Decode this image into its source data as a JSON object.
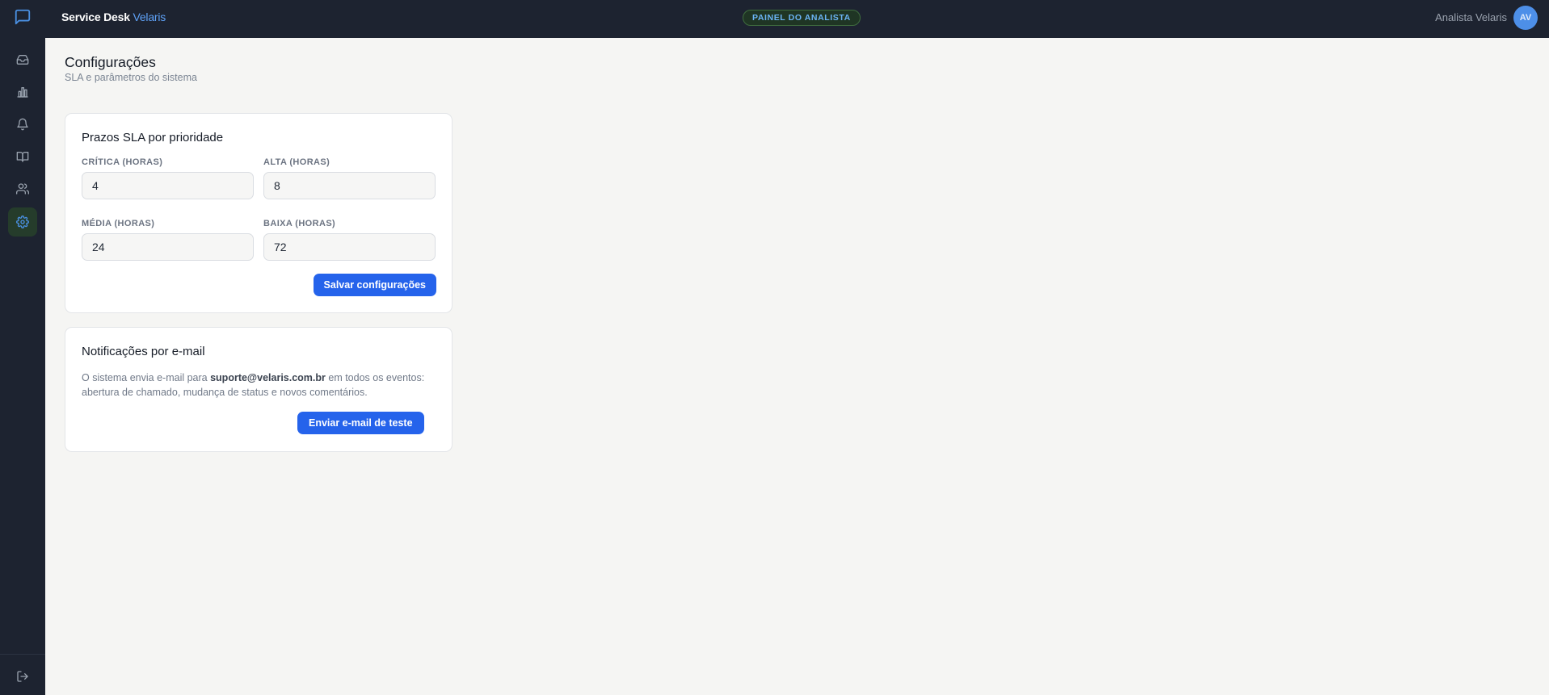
{
  "header": {
    "brand_primary": "Service Desk",
    "brand_accent": "Velaris",
    "badge": "PAINEL DO ANALISTA",
    "user_name": "Analista Velaris",
    "avatar_initials": "AV"
  },
  "sidebar": {
    "items": [
      {
        "icon": "inbox-icon",
        "active": false
      },
      {
        "icon": "bar-chart-icon",
        "active": false
      },
      {
        "icon": "bell-icon",
        "active": false
      },
      {
        "icon": "book-icon",
        "active": false
      },
      {
        "icon": "users-icon",
        "active": false
      },
      {
        "icon": "settings-icon",
        "active": true
      }
    ],
    "footer_icon": "logout-icon"
  },
  "page": {
    "title": "Configurações",
    "subtitle": "SLA e parâmetros do sistema"
  },
  "sla_card": {
    "title": "Prazos SLA por prioridade",
    "fields": [
      {
        "label": "CRÍTICA (HORAS)",
        "value": "4"
      },
      {
        "label": "ALTA (HORAS)",
        "value": "8"
      },
      {
        "label": "MÉDIA (HORAS)",
        "value": "24"
      },
      {
        "label": "BAIXA (HORAS)",
        "value": "72"
      }
    ],
    "save_label": "Salvar configurações"
  },
  "email_card": {
    "title": "Notificações por e-mail",
    "text_before": "O sistema envia e-mail para ",
    "email": "suporte@velaris.com.br",
    "text_after": " em todos os eventos: abertura de chamado, mudança de status e novos comentários.",
    "test_label": "Enviar e-mail de teste"
  },
  "colors": {
    "chrome_bg": "#1d2330",
    "accent_blue": "#2563eb",
    "active_nav_bg": "#253c2b",
    "active_nav_icon": "#4a90e2"
  }
}
